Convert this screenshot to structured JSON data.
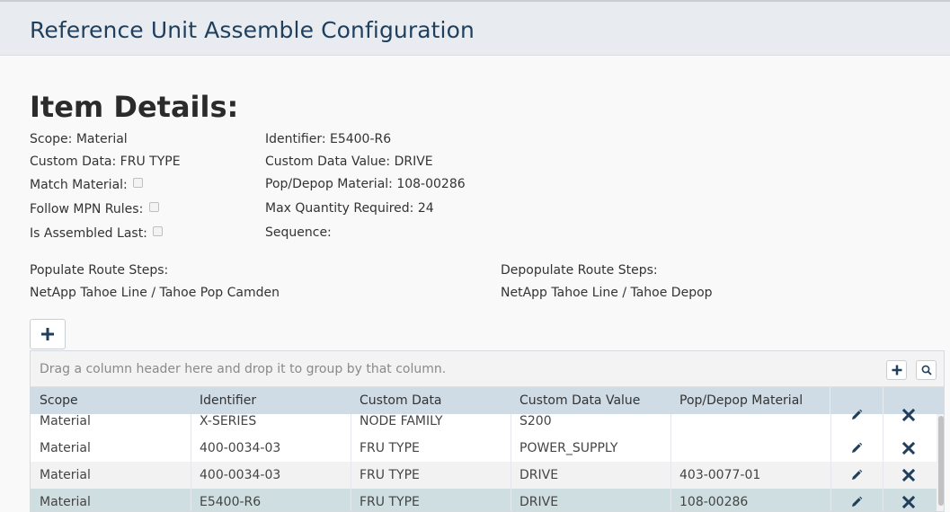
{
  "header": {
    "title": "Reference Unit Assemble Configuration"
  },
  "details": {
    "section_title": "Item Details:",
    "left": {
      "scope": "Scope: Material",
      "custom_data": "Custom Data: FRU TYPE",
      "match_material": "Match Material:",
      "follow_mpn": "Follow MPN Rules:",
      "assembled_last": "Is Assembled Last:"
    },
    "right": {
      "identifier": "Identifier: E5400-R6",
      "custom_data_value": "Custom Data Value: DRIVE",
      "pop_depop": "Pop/Depop Material: 108-00286",
      "max_qty": "Max Quantity Required: 24",
      "sequence": "Sequence:"
    },
    "populate_label": "Populate Route Steps:",
    "populate_value": "NetApp Tahoe Line / Tahoe Pop Camden",
    "depopulate_label": "Depopulate Route Steps:",
    "depopulate_value": "NetApp Tahoe Line / Tahoe Depop"
  },
  "grid": {
    "group_hint": "Drag a column header here and drop it to group by that column.",
    "columns": [
      "Scope",
      "Identifier",
      "Custom Data",
      "Custom Data Value",
      "Pop/Depop Material"
    ],
    "rows": [
      {
        "scope": "Material",
        "identifier": "X-SERIES",
        "custom_data": "NODE FAMILY",
        "custom_data_value": "S200",
        "pop_depop": ""
      },
      {
        "scope": "Material",
        "identifier": "400-0034-03",
        "custom_data": "FRU TYPE",
        "custom_data_value": "POWER_SUPPLY",
        "pop_depop": ""
      },
      {
        "scope": "Material",
        "identifier": "400-0034-03",
        "custom_data": "FRU TYPE",
        "custom_data_value": "DRIVE",
        "pop_depop": "403-0077-01"
      },
      {
        "scope": "Material",
        "identifier": "E5400-R6",
        "custom_data": "FRU TYPE",
        "custom_data_value": "DRIVE",
        "pop_depop": "108-00286"
      }
    ]
  },
  "colors": {
    "accent": "#1f3f5c",
    "header_bg": "#e8ecf0",
    "grid_header": "#cfdbe5",
    "selected_row": "#cfdfe1"
  },
  "icons": {
    "add": "plus-icon",
    "search": "magnifier-icon",
    "edit": "pencil-icon",
    "delete": "x-icon"
  }
}
